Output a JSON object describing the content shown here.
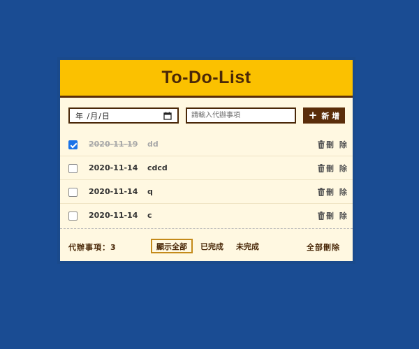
{
  "header": {
    "title": "To-Do-List"
  },
  "form": {
    "date_display": "年 /月/日",
    "text_placeholder": "請輸入代辦事項",
    "add_label": "新 增"
  },
  "items": [
    {
      "date": "2020-11-19",
      "text": "dd",
      "done": true,
      "delete_label": "刪 除"
    },
    {
      "date": "2020-11-14",
      "text": "cdcd",
      "done": false,
      "delete_label": "刪 除"
    },
    {
      "date": "2020-11-14",
      "text": "q",
      "done": false,
      "delete_label": "刪 除"
    },
    {
      "date": "2020-11-14",
      "text": "c",
      "done": false,
      "delete_label": "刪 除"
    }
  ],
  "footer": {
    "count_label": "代辦事項：3",
    "filters": [
      {
        "label": "顯示全部",
        "active": true
      },
      {
        "label": "已完成",
        "active": false
      },
      {
        "label": "未完成",
        "active": false
      }
    ],
    "clear_label": "全部刪除"
  },
  "colors": {
    "background": "#1a4c93",
    "header": "#fbc100",
    "card": "#fff8e1",
    "brown": "#5a2d0a",
    "checkbox_checked": "#1a73e8"
  },
  "icons": [
    "calendar-icon",
    "plus-icon",
    "trash-icon"
  ]
}
